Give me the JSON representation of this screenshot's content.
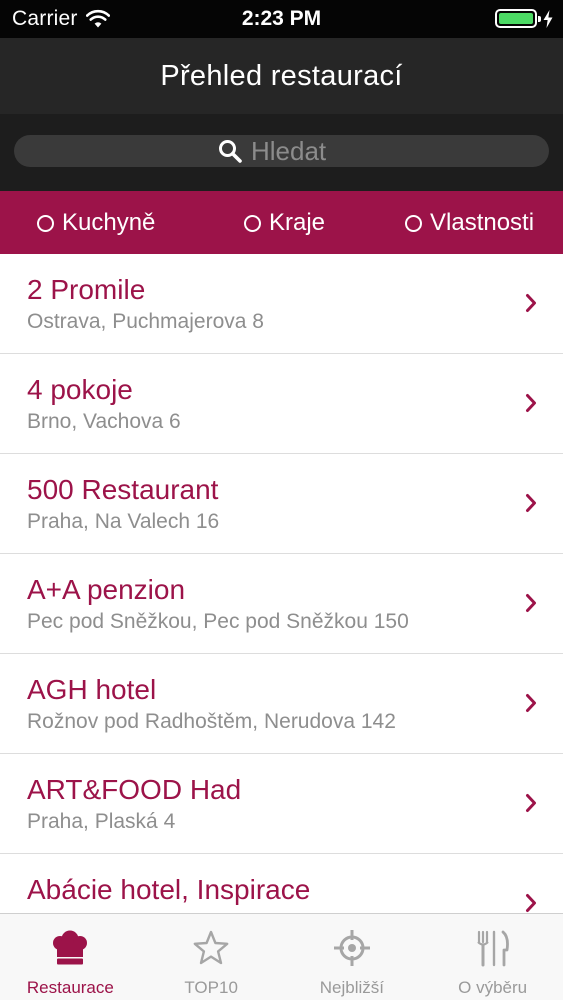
{
  "status_bar": {
    "carrier": "Carrier",
    "time": "2:23 PM",
    "battery_level": 1.0,
    "battery_color": "#4cd964"
  },
  "nav": {
    "title": "Přehled restaurací"
  },
  "search": {
    "placeholder": "Hledat",
    "value": "",
    "icon": "search-icon"
  },
  "filters": [
    {
      "label": "Kuchyně",
      "selected": false
    },
    {
      "label": "Kraje",
      "selected": false
    },
    {
      "label": "Vlastnosti",
      "selected": false
    }
  ],
  "restaurants": [
    {
      "name": "2 Promile",
      "address": "Ostrava, Puchmajerova 8"
    },
    {
      "name": "4 pokoje",
      "address": "Brno, Vachova 6"
    },
    {
      "name": "500 Restaurant",
      "address": "Praha, Na Valech 16"
    },
    {
      "name": "A+A penzion",
      "address": "Pec pod Sněžkou, Pec pod Sněžkou 150"
    },
    {
      "name": "AGH hotel",
      "address": "Rožnov pod Radhoštěm, Nerudova 142"
    },
    {
      "name": "ART&FOOD Had",
      "address": "Praha, Plaská 4"
    },
    {
      "name": "Abácie hotel, Inspirace",
      "address": ""
    }
  ],
  "tabs": [
    {
      "label": "Restaurace",
      "icon": "chef-hat-icon",
      "active": true
    },
    {
      "label": "TOP10",
      "icon": "star-icon",
      "active": false
    },
    {
      "label": "Nejbližší",
      "icon": "crosshair-icon",
      "active": false
    },
    {
      "label": "O výběru",
      "icon": "cutlery-icon",
      "active": false
    }
  ],
  "colors": {
    "accent": "#9c1349",
    "nav_background": "#262626",
    "secondary_text": "#8e8e8e",
    "tab_inactive": "#9a9a9a"
  }
}
